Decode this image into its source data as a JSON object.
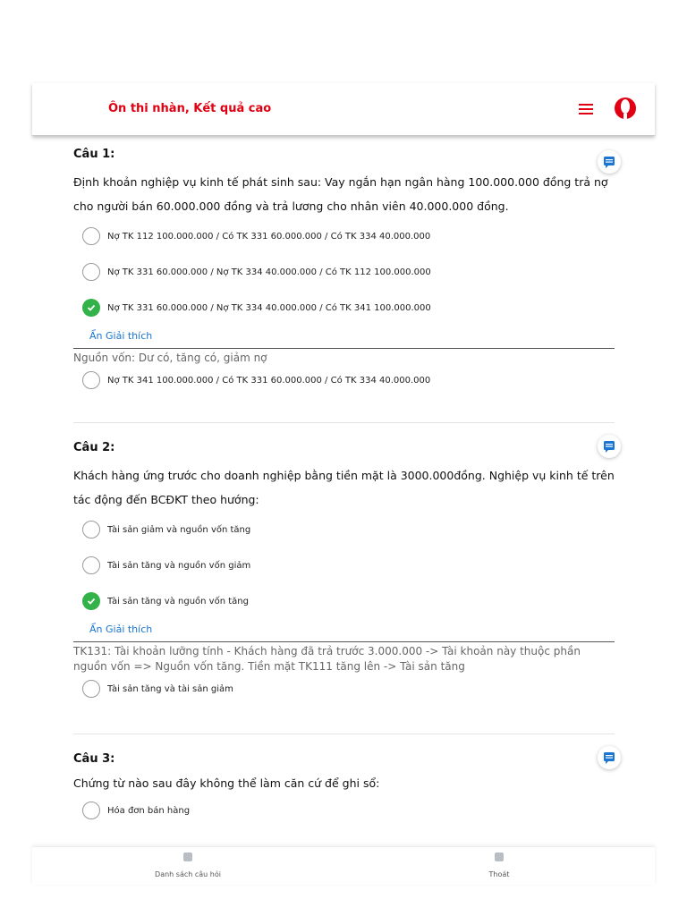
{
  "header": {
    "brand": "Ôn thi nhàn, Kết quả cao",
    "menu_icon": "hamburger-icon",
    "avatar_icon": "user-avatar-icon"
  },
  "colors": {
    "accent": "#e00012",
    "check": "#33b249",
    "link": "#1976d2"
  },
  "questions": [
    {
      "title": "Câu 1:",
      "text": "Định khoản nghiệp vụ kinh tế phát sinh sau: Vay ngắn hạn ngân hàng 100.000.000 đồng trả nợ cho người bán 60.000.000 đồng và trả lương cho nhân viên 40.000.000 đồng.",
      "options": [
        "Nợ TK 112 100.000.000 / Có TK 331 60.000.000 / Có TK 334 40.000.000",
        "Nợ TK 331 60.000.000 / Nợ TK 334 40.000.000 / Có TK 112 100.000.000",
        "Nợ TK 331 60.000.000 / Nợ TK 334 40.000.000 / Có TK 341 100.000.000",
        "Nợ TK 341 100.000.000 / Có TK 331 60.000.000 / Có TK 334 40.000.000"
      ],
      "selected": "Nợ TK 331 60.000.000 / Nợ TK 334 40.000.000 / Có TK 341 100.000.000",
      "explain_label": "Ẩn Giải thích",
      "explanation": "Nguồn vốn: Dư có, tăng có, giảm nợ"
    },
    {
      "title": "Câu 2:",
      "text": "Khách hàng ứng trước cho doanh nghiệp bằng tiền mặt là 3000.000đồng. Nghiệp vụ kinh tế trên tác động đến BCĐKT theo hướng:",
      "options": [
        "Tài sản giảm và nguồn vốn tăng",
        "Tài sản tăng và nguồn vốn giảm",
        "Tài sản tăng và nguồn vốn tăng",
        "Tài sản tăng và tài sản giảm"
      ],
      "selected": "Tài sản tăng và nguồn vốn tăng",
      "explain_label": "Ẩn Giải thích",
      "explanation": "TK131: Tài khoản lưỡng tính - Khách hàng đã trả trước 3.000.000 -> Tài khoản này thuộc phần nguồn vốn => Nguồn vốn tăng. Tiền mặt TK111 tăng lên -> Tài sản tăng"
    },
    {
      "title": "Câu 3:",
      "text": "Chứng từ nào sau đây không thể làm căn cứ để ghi sổ:",
      "options": [
        "Hóa đơn bán hàng"
      ]
    }
  ],
  "bottom_nav": [
    {
      "label": "Danh sách câu hỏi",
      "icon": "question-list-icon"
    },
    {
      "label": "Thoát",
      "icon": "exit-icon"
    }
  ]
}
